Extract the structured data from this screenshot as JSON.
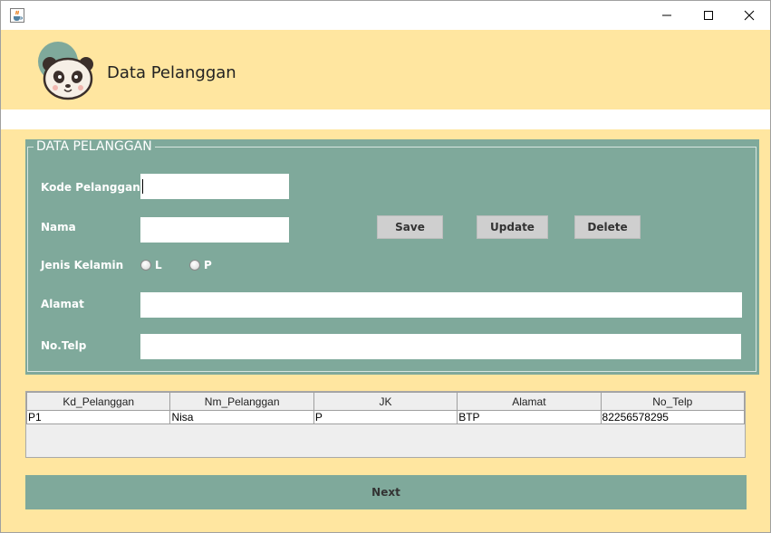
{
  "window": {
    "icon": "java-cup-icon",
    "controls": {
      "minimize": "minimize-icon",
      "maximize": "maximize-icon",
      "close": "close-icon"
    }
  },
  "header": {
    "title": "Data Pelanggan",
    "logo": "panda-icon"
  },
  "form": {
    "legend": "DATA PELANGGAN",
    "kode_label": "Kode Pelanggan",
    "kode_value": "",
    "nama_label": "Nama",
    "nama_value": "",
    "jk_label": "Jenis Kelamin",
    "jk_option_l": "L",
    "jk_option_p": "P",
    "alamat_label": "Alamat",
    "alamat_value": "",
    "telp_label": "No.Telp",
    "telp_value": "",
    "save_label": "Save",
    "update_label": "Update",
    "delete_label": "Delete"
  },
  "table": {
    "columns": [
      "Kd_Pelanggan",
      "Nm_Pelanggan",
      "JK",
      "Alamat",
      "No_Telp"
    ],
    "rows": [
      [
        "P1",
        "Nisa",
        "P",
        "BTP",
        "82256578295"
      ]
    ]
  },
  "footer": {
    "next_label": "Next"
  },
  "colors": {
    "background": "#ffe6a0",
    "panel": "#7fa99b",
    "button": "#cfcfcf"
  }
}
